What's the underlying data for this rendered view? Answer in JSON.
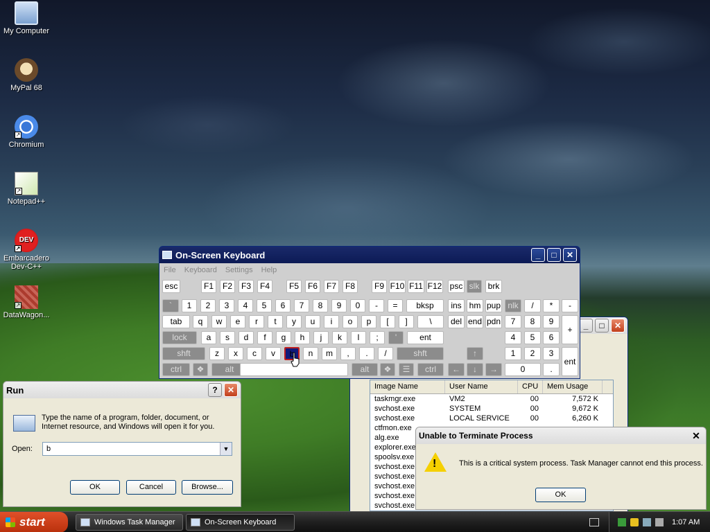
{
  "desktop": {
    "icons": [
      {
        "label": "My Computer"
      },
      {
        "label": "MyPal 68"
      },
      {
        "label": "Chromium"
      },
      {
        "label": "Notepad++"
      },
      {
        "label": "Embarcadero Dev-C++"
      },
      {
        "label": "DataWagon..."
      }
    ]
  },
  "osk": {
    "title": "On-Screen Keyboard",
    "menu": [
      "File",
      "Keyboard",
      "Settings",
      "Help"
    ],
    "selected_key": "b"
  },
  "task_manager": {
    "columns": [
      "Image Name",
      "User Name",
      "CPU",
      "Mem Usage"
    ],
    "rows": [
      {
        "image": "taskmgr.exe",
        "user": "VM2",
        "cpu": "00",
        "mem": "7,572 K"
      },
      {
        "image": "svchost.exe",
        "user": "SYSTEM",
        "cpu": "00",
        "mem": "9,672 K"
      },
      {
        "image": "svchost.exe",
        "user": "LOCAL SERVICE",
        "cpu": "00",
        "mem": "6,260 K"
      },
      {
        "image": "ctfmon.exe",
        "user": "",
        "cpu": "",
        "mem": ""
      },
      {
        "image": "alg.exe",
        "user": "",
        "cpu": "",
        "mem": ""
      },
      {
        "image": "explorer.exe",
        "user": "",
        "cpu": "",
        "mem": ""
      },
      {
        "image": "spoolsv.exe",
        "user": "",
        "cpu": "",
        "mem": ""
      },
      {
        "image": "svchost.exe",
        "user": "",
        "cpu": "",
        "mem": ""
      },
      {
        "image": "svchost.exe",
        "user": "",
        "cpu": "",
        "mem": ""
      },
      {
        "image": "svchost.exe",
        "user": "",
        "cpu": "",
        "mem": ""
      },
      {
        "image": "svchost.exe",
        "user": "",
        "cpu": "",
        "mem": ""
      },
      {
        "image": "svchost.exe",
        "user": "",
        "cpu": "",
        "mem": ""
      }
    ]
  },
  "run": {
    "title": "Run",
    "help_glyph": "?",
    "description": "Type the name of a program, folder, document, or Internet resource, and Windows will open it for you.",
    "open_label": "Open:",
    "open_value": "b",
    "ok": "OK",
    "cancel": "Cancel",
    "browse": "Browse..."
  },
  "error": {
    "title": "Unable to Terminate Process",
    "message": "This is a critical system process.  Task Manager cannot end this process.",
    "ok": "OK"
  },
  "taskbar": {
    "start": "start",
    "tasks": [
      "Windows Task Manager",
      "On-Screen Keyboard"
    ],
    "clock": "1:07 AM"
  }
}
